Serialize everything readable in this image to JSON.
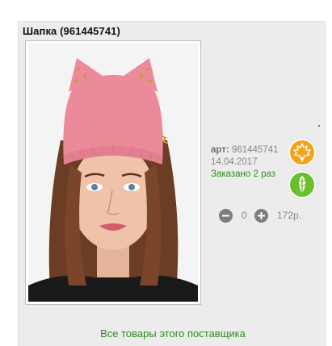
{
  "product": {
    "title": "Шапка (961445741)",
    "art_label": "арт:",
    "art_number": "961445741",
    "date": "14.04.2017",
    "ordered_text": "Заказано 2 раз",
    "quantity": "0",
    "price": "172р."
  },
  "footer": {
    "supplier_link": "Все товары этого поставщика"
  },
  "icons": {
    "badge_orange": "maple-leaf-icon",
    "badge_green": "leaf-icon",
    "minus": "minus-circle-icon",
    "plus": "plus-circle-icon"
  },
  "colors": {
    "card_background": "#ececec",
    "link_green": "#2e8b1e",
    "badge_orange": "#f3a21d",
    "badge_green": "#6bbf2d",
    "hat_pink": "#ec8a9b"
  }
}
